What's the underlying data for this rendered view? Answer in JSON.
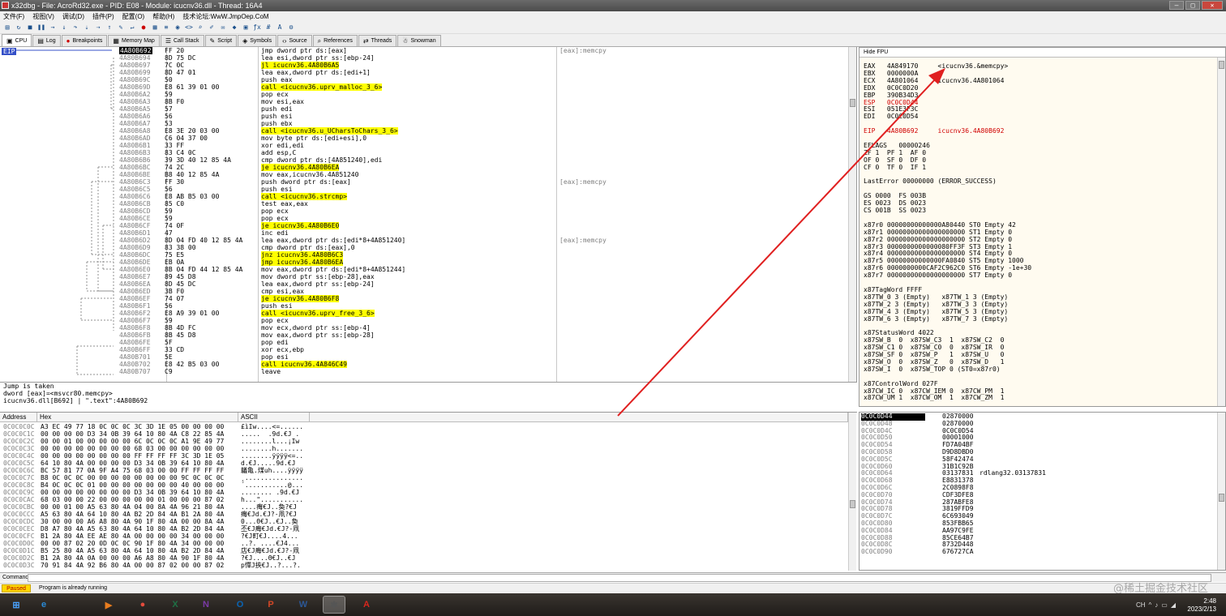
{
  "titlebar": {
    "title": "x32dbg - File: AcroRd32.exe - PID: E08 - Module: icucnv36.dll - Thread: 16A4"
  },
  "menu": {
    "items": [
      "文件(F)",
      "视图(V)",
      "调试(D)",
      "插件(P)",
      "配置(O)",
      "帮助(H)",
      "技术论坛:WwW.JmpOep.CoM"
    ]
  },
  "tabs": [
    {
      "label": "CPU",
      "icon": "cpu-icon"
    },
    {
      "label": "Log",
      "icon": "log-icon"
    },
    {
      "label": "Breakpoints",
      "icon": "breakpoint-icon"
    },
    {
      "label": "Memory Map",
      "icon": "memory-icon"
    },
    {
      "label": "Call Stack",
      "icon": "callstack-icon"
    },
    {
      "label": "Script",
      "icon": "script-icon"
    },
    {
      "label": "Symbols",
      "icon": "symbols-icon"
    },
    {
      "label": "Source",
      "icon": "source-icon"
    },
    {
      "label": "References",
      "icon": "references-icon"
    },
    {
      "label": "Threads",
      "icon": "threads-icon"
    },
    {
      "label": "Snowman",
      "icon": "snowman-icon"
    }
  ],
  "disasm": {
    "eip_label": "EIP",
    "rows": [
      {
        "addr": "4A80B692",
        "bytes": "FF 20",
        "instr": "jmp dword ptr ds:[eax]",
        "comment": "[eax]:memcpy",
        "sel": true
      },
      {
        "addr": "4A80B694",
        "bytes": "8D 75 DC",
        "instr": "lea esi,dword ptr ss:[ebp-24]"
      },
      {
        "addr": "4A80B697",
        "bytes": "7C 0C",
        "instr": "jl icucnv36.4A80B6A5",
        "hl": true
      },
      {
        "addr": "4A80B699",
        "bytes": "8D 47 01",
        "instr": "lea eax,dword ptr ds:[edi+1]"
      },
      {
        "addr": "4A80B69C",
        "bytes": "50",
        "instr": "push eax"
      },
      {
        "addr": "4A80B69D",
        "bytes": "E8 61 39 01 00",
        "instr": "call <icucnv36.uprv_malloc_3_6>",
        "hl": true
      },
      {
        "addr": "4A80B6A2",
        "bytes": "59",
        "instr": "pop ecx"
      },
      {
        "addr": "4A80B6A3",
        "bytes": "8B F0",
        "instr": "mov esi,eax"
      },
      {
        "addr": "4A80B6A5",
        "bytes": "57",
        "instr": "push edi"
      },
      {
        "addr": "4A80B6A6",
        "bytes": "56",
        "instr": "push esi"
      },
      {
        "addr": "4A80B6A7",
        "bytes": "53",
        "instr": "push ebx"
      },
      {
        "addr": "4A80B6A8",
        "bytes": "E8 3E 20 03 00",
        "instr": "call <icucnv36.u_UCharsToChars_3_6>",
        "hl": true
      },
      {
        "addr": "4A80B6AD",
        "bytes": "C6 04 37 00",
        "instr": "mov byte ptr ds:[edi+esi],0"
      },
      {
        "addr": "4A80B6B1",
        "bytes": "33 FF",
        "instr": "xor edi,edi"
      },
      {
        "addr": "4A80B6B3",
        "bytes": "83 C4 0C",
        "instr": "add esp,C"
      },
      {
        "addr": "4A80B6B6",
        "bytes": "39 3D 40 12 85 4A",
        "instr": "cmp dword ptr ds:[4A851240],edi"
      },
      {
        "addr": "4A80B6BC",
        "bytes": "74 2C",
        "instr": "je icucnv36.4A80B6EA",
        "hl": true
      },
      {
        "addr": "4A80B6BE",
        "bytes": "B8 40 12 85 4A",
        "instr": "mov eax,icucnv36.4A851240"
      },
      {
        "addr": "4A80B6C3",
        "bytes": "FF 30",
        "instr": "push dword ptr ds:[eax]",
        "comment": "[eax]:memcpy"
      },
      {
        "addr": "4A80B6C5",
        "bytes": "56",
        "instr": "push esi"
      },
      {
        "addr": "4A80B6C6",
        "bytes": "E8 AB B5 03 00",
        "instr": "call <icucnv36.strcmp>",
        "hl": true
      },
      {
        "addr": "4A80B6CB",
        "bytes": "85 C0",
        "instr": "test eax,eax"
      },
      {
        "addr": "4A80B6CD",
        "bytes": "59",
        "instr": "pop ecx"
      },
      {
        "addr": "4A80B6CE",
        "bytes": "59",
        "instr": "pop ecx"
      },
      {
        "addr": "4A80B6CF",
        "bytes": "74 0F",
        "instr": "je icucnv36.4A80B6E0",
        "hl": true
      },
      {
        "addr": "4A80B6D1",
        "bytes": "47",
        "instr": "inc edi"
      },
      {
        "addr": "4A80B6D2",
        "bytes": "8D 04 FD 40 12 85 4A",
        "instr": "lea eax,dword ptr ds:[edi*8+4A851240]",
        "comment": "[eax]:memcpy"
      },
      {
        "addr": "4A80B6D9",
        "bytes": "83 38 00",
        "instr": "cmp dword ptr ds:[eax],0"
      },
      {
        "addr": "4A80B6DC",
        "bytes": "75 E5",
        "instr": "jnz icucnv36.4A80B6C3",
        "hl": true
      },
      {
        "addr": "4A80B6DE",
        "bytes": "EB 0A",
        "instr": "jmp icucnv36.4A80B6EA",
        "hl": true
      },
      {
        "addr": "4A80B6E0",
        "bytes": "8B 04 FD 44 12 85 4A",
        "instr": "mov eax,dword ptr ds:[edi*8+4A851244]"
      },
      {
        "addr": "4A80B6E7",
        "bytes": "89 45 D8",
        "instr": "mov dword ptr ss:[ebp-28],eax"
      },
      {
        "addr": "4A80B6EA",
        "bytes": "8D 45 DC",
        "instr": "lea eax,dword ptr ss:[ebp-24]"
      },
      {
        "addr": "4A80B6ED",
        "bytes": "3B F0",
        "instr": "cmp esi,eax"
      },
      {
        "addr": "4A80B6EF",
        "bytes": "74 07",
        "instr": "je icucnv36.4A80B6F8",
        "hl": true
      },
      {
        "addr": "4A80B6F1",
        "bytes": "56",
        "instr": "push esi"
      },
      {
        "addr": "4A80B6F2",
        "bytes": "E8 A9 39 01 00",
        "instr": "call <icucnv36.uprv_free_3_6>",
        "hl": true
      },
      {
        "addr": "4A80B6F7",
        "bytes": "59",
        "instr": "pop ecx"
      },
      {
        "addr": "4A80B6F8",
        "bytes": "8B 4D FC",
        "instr": "mov ecx,dword ptr ss:[ebp-4]"
      },
      {
        "addr": "4A80B6FB",
        "bytes": "8B 45 D8",
        "instr": "mov eax,dword ptr ss:[ebp-28]"
      },
      {
        "addr": "4A80B6FE",
        "bytes": "5F",
        "instr": "pop edi"
      },
      {
        "addr": "4A80B6FF",
        "bytes": "33 CD",
        "instr": "xor ecx,ebp"
      },
      {
        "addr": "4A80B701",
        "bytes": "5E",
        "instr": "pop esi"
      },
      {
        "addr": "4A80B702",
        "bytes": "E8 42 B5 03 00",
        "instr": "call icucnv36.4A846C49",
        "hl": true
      },
      {
        "addr": "4A80B707",
        "bytes": "C9",
        "instr": "leave"
      }
    ]
  },
  "info": {
    "lines": [
      "Jump is taken",
      "dword [eax]=<msvcr80.memcpy>",
      "icucnv36.dll[B692] | \".text\":4A80B692"
    ]
  },
  "registers": {
    "header": "Hide FPU",
    "lines": [
      "EAX   4A849170     <icucnv36.&memcpy>",
      "EBX   0000000A",
      "ECX   4A801064     icucnv36.4A801064",
      "EDX   0C0C0D20",
      "EBP   390B34D3",
      "ESP   0C0C0D44",
      "ESI   051E3F3C",
      "EDI   0C0C0D54",
      "",
      "EIP   4A80B692     icucnv36.4A80B692",
      "",
      "EFLAGS   00000246",
      "ZF 1  PF 1  AF 0",
      "OF 0  SF 0  DF 0",
      "CF 0  TF 0  IF 1",
      "",
      "LastError 00000000 (ERROR_SUCCESS)",
      "",
      "GS 0000  FS 003B",
      "ES 0023  DS 0023",
      "CS 001B  SS 0023",
      "",
      "x87r0 00000000000000A80440 ST0 Empty 42",
      "x87r1 00000000000000000000 ST1 Empty 0",
      "x87r2 00000000000000000000 ST2 Empty 0",
      "x87r3 0000000000000080FF3F ST3 Empty 1",
      "x87r4 00000000000000000000 ST4 Empty 0",
      "x87r5 00000000000000FA0840 ST5 Empty 1000",
      "x87r6 0000000000CAF2C962C0 ST6 Empty -1e+30",
      "x87r7 00000000000000000000 ST7 Empty 0",
      "",
      "x87TagWord FFFF",
      "x87TW_0 3 (Empty)   x87TW_1 3 (Empty)",
      "x87TW_2 3 (Empty)   x87TW_3 3 (Empty)",
      "x87TW_4 3 (Empty)   x87TW_5 3 (Empty)",
      "x87TW_6 3 (Empty)   x87TW_7 3 (Empty)",
      "",
      "x87StatusWord 4022",
      "x87SW_B  0  x87SW_C3  1  x87SW_C2  0",
      "x87SW_C1 0  x87SW_C0  0  x87SW_IR  0",
      "x87SW_SF 0  x87SW_P   1  x87SW_U   0",
      "x87SW_O  0  x87SW_Z   0  x87SW_D   1",
      "x87SW_I  0  x87SW_TOP 0 (ST0=x87r0)",
      "",
      "x87ControlWord 027F",
      "x87CW_IC 0  x87CW_IEM 0  x87CW_PM  1",
      "x87CW_UM 1  x87CW_OM  1  x87CW_ZM  1"
    ],
    "changed_color": "#d00000"
  },
  "dump": {
    "headers": [
      "Address",
      "Hex",
      "ASCII"
    ],
    "rows": [
      {
        "a": "0C0C0C0C",
        "h": "A3 EC 49 77 18 0C 0C 0C 3C 3D 1E 05 00 00 00 00",
        "s": "£ìIw....<=......"
      },
      {
        "a": "0C0C0C1C",
        "h": "00 00 00 00 D3 34 0B 39 64 10 80 4A C8 22 85 4A",
        "s": ".....  .9d.€J ."
      },
      {
        "a": "0C0C0C2C",
        "h": "00 00 01 00 00 00 00 00 6C 0C 0C 0C A1 9E 49 77",
        "s": "........l...¡Iw"
      },
      {
        "a": "0C0C0C3C",
        "h": "00 00 00 00 00 00 00 00 68 03 00 00 00 00 00 00",
        "s": "........h......."
      },
      {
        "a": "0C0C0C4C",
        "h": "00 00 00 00 00 00 00 00 FF FF FF FF 3C 3D 1E 05",
        "s": "........ÿÿÿÿ<=.."
      },
      {
        "a": "0C0C0C5C",
        "h": "64 10 80 4A 00 00 00 00 D3 34 0B 39 64 10 80 4A",
        "s": "d.€J.....9d.€J"
      },
      {
        "a": "0C0C0C6C",
        "h": "BC 57 81 77 0A 9F A4 75 68 03 00 00 FF FF FF FF",
        "s": "鸃亀.煤uh....ÿÿÿÿ"
      },
      {
        "a": "0C0C0C7C",
        "h": "B8 0C 0C 0C 00 00 00 00 00 00 00 00 9C 0C 0C 0C",
        "s": "¸..............."
      },
      {
        "a": "0C0C0C8C",
        "h": "B4 0C 0C 0C 01 00 00 00 00 00 00 00 40 00 00 00",
        "s": "´...........@..."
      },
      {
        "a": "0C0C0C9C",
        "h": "00 00 00 00 00 00 00 00 D3 34 0B 39 64 10 80 4A",
        "s": "........ .9d.€J"
      },
      {
        "a": "0C0C0CAC",
        "h": "68 03 00 00 22 00 00 00 00 00 01 00 00 00 87 02",
        "s": "h...\"..........."
      },
      {
        "a": "0C0C0CBC",
        "h": "00 00 01 00 A5 63 80 4A 04 00 8A 4A 96 21 80 4A",
        "s": "....痗€J..奐?€J"
      },
      {
        "a": "0C0C0CCC",
        "h": "A5 63 80 4A 64 10 80 4A B2 2D 84 4A B1 2A 80 4A",
        "s": "痗€Jd.€J?-凧?€J"
      },
      {
        "a": "0C0C0CDC",
        "h": "30 00 00 00 A6 A8 80 4A 90 1F 80 4A 00 00 8A 4A",
        "s": "0...Θ€J..€J..奐"
      },
      {
        "a": "0C0C0CEC",
        "h": "D8 A7 80 4A A5 63 80 4A 64 10 80 4A B2 2D 84 4A",
        "s": "丕€J痗€Jd.€J?-凧"
      },
      {
        "a": "0C0C0CFC",
        "h": "B1 2A 80 4A EE AE 80 4A 00 00 00 00 34 00 00 00",
        "s": "?€J町€J....4..."
      },
      {
        "a": "0C0C0D0C",
        "h": "00 00 87 02 20 0D 0C 0C 90 1F 80 4A 34 00 00 00",
        "s": "..?. ....€J4..."
      },
      {
        "a": "0C0C0D1C",
        "h": "B5 25 80 4A A5 63 80 4A 64 10 80 4A B2 2D 84 4A",
        "s": "店€J痗€Jd.€J?-凧"
      },
      {
        "a": "0C0C0D2C",
        "h": "B1 2A 80 4A 0A 00 00 00 A6 A8 80 4A 90 1F 80 4A",
        "s": "?€J....Θ€J..€J"
      },
      {
        "a": "0C0C0D3C",
        "h": "70 91 84 4A 92 B6 80 4A 00 00 87 02 00 00 87 02",
        "s": "p憚J挾€J..?...?."
      }
    ]
  },
  "stack": {
    "rows": [
      {
        "a": "0C0C0D44",
        "v": "02870000",
        "c": "",
        "top": true
      },
      {
        "a": "0C0C0D48",
        "v": "02870000",
        "c": ""
      },
      {
        "a": "0C0C0D4C",
        "v": "0C0C0D54",
        "c": ""
      },
      {
        "a": "0C0C0D50",
        "v": "00001000",
        "c": ""
      },
      {
        "a": "0C0C0D54",
        "v": "FD7A04BF",
        "c": ""
      },
      {
        "a": "0C0C0D58",
        "v": "D9D8DBD0",
        "c": ""
      },
      {
        "a": "0C0C0D5C",
        "v": "58F42474",
        "c": ""
      },
      {
        "a": "0C0C0D60",
        "v": "31B1C92B",
        "c": ""
      },
      {
        "a": "0C0C0D64",
        "v": "03137831",
        "c": "rdlang32.03137831"
      },
      {
        "a": "0C0C0D68",
        "v": "E8831378",
        "c": ""
      },
      {
        "a": "0C0C0D6C",
        "v": "2C0898F8",
        "c": ""
      },
      {
        "a": "0C0C0D70",
        "v": "CDF3DFE8",
        "c": ""
      },
      {
        "a": "0C0C0D74",
        "v": "287ABFE8",
        "c": ""
      },
      {
        "a": "0C0C0D78",
        "v": "3819FFD9",
        "c": ""
      },
      {
        "a": "0C0C0D7C",
        "v": "6C693049",
        "c": ""
      },
      {
        "a": "0C0C0D80",
        "v": "853FBB65",
        "c": ""
      },
      {
        "a": "0C0C0D84",
        "v": "AA97C9FE",
        "c": ""
      },
      {
        "a": "0C0C0D88",
        "v": "85CE64B7",
        "c": ""
      },
      {
        "a": "0C0C0D8C",
        "v": "8732D448",
        "c": ""
      },
      {
        "a": "0C0C0D90",
        "v": "676727CA",
        "c": ""
      }
    ]
  },
  "command": {
    "label": "Command:"
  },
  "status": {
    "badge": "Paused",
    "text": "Program is already running"
  },
  "taskbar": {
    "apps": [
      {
        "name": "start-button",
        "glyph": "⊞",
        "color": "#4aa3ff"
      },
      {
        "name": "internet-explorer",
        "glyph": "e",
        "color": "#2a8bd8"
      },
      {
        "name": "media-player",
        "glyph": "▶",
        "color": "#e87c1e"
      },
      {
        "name": "chrome",
        "glyph": "●",
        "color": "#e44b3c"
      },
      {
        "name": "excel",
        "glyph": "X",
        "color": "#1e7145"
      },
      {
        "name": "onenote",
        "glyph": "N",
        "color": "#7a3aa6"
      },
      {
        "name": "outlook",
        "glyph": "O",
        "color": "#0a64b4"
      },
      {
        "name": "powerpoint",
        "glyph": "P",
        "color": "#d24726"
      },
      {
        "name": "word",
        "glyph": "W",
        "color": "#2b5797"
      },
      {
        "name": "x32dbg",
        "glyph": "✱",
        "color": "#555555",
        "active": true
      },
      {
        "name": "acrobat",
        "glyph": "A",
        "color": "#d8261c"
      }
    ],
    "tray": [
      "CH",
      "^",
      "♪",
      "▭",
      "◢"
    ],
    "time": "2:48",
    "date": "2023/2/13"
  },
  "watermark": "@稀土掘金技术社区",
  "colors": {
    "accent": "#3550c8",
    "highlight": "#ffff00",
    "call": "#00e5ff",
    "annotation_arrow": "#e02020"
  }
}
